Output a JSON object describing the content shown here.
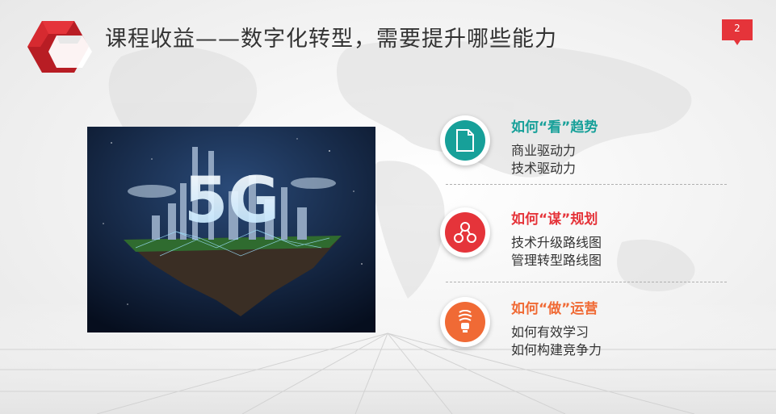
{
  "header": {
    "title": "课程收益——数字化转型，需要提升哪些能力",
    "page_number": "2"
  },
  "photo": {
    "overlay_text": "5G"
  },
  "items": [
    {
      "heading": "如何“看”趋势",
      "lines": [
        "商业驱动力",
        "技术驱动力"
      ],
      "color": "#17a099",
      "icon": "document-icon"
    },
    {
      "heading": "如何“谋”规划",
      "lines": [
        "技术升级路线图",
        "管理转型路线图"
      ],
      "color": "#e5343a",
      "icon": "network-icon"
    },
    {
      "heading": "如何“做”运营",
      "lines": [
        "如何有效学习",
        "如何构建竞争力"
      ],
      "color": "#f06a35",
      "icon": "lightbulb-icon"
    }
  ],
  "colors": {
    "accent_red": "#e5343a",
    "teal": "#17a099",
    "orange": "#f06a35"
  }
}
